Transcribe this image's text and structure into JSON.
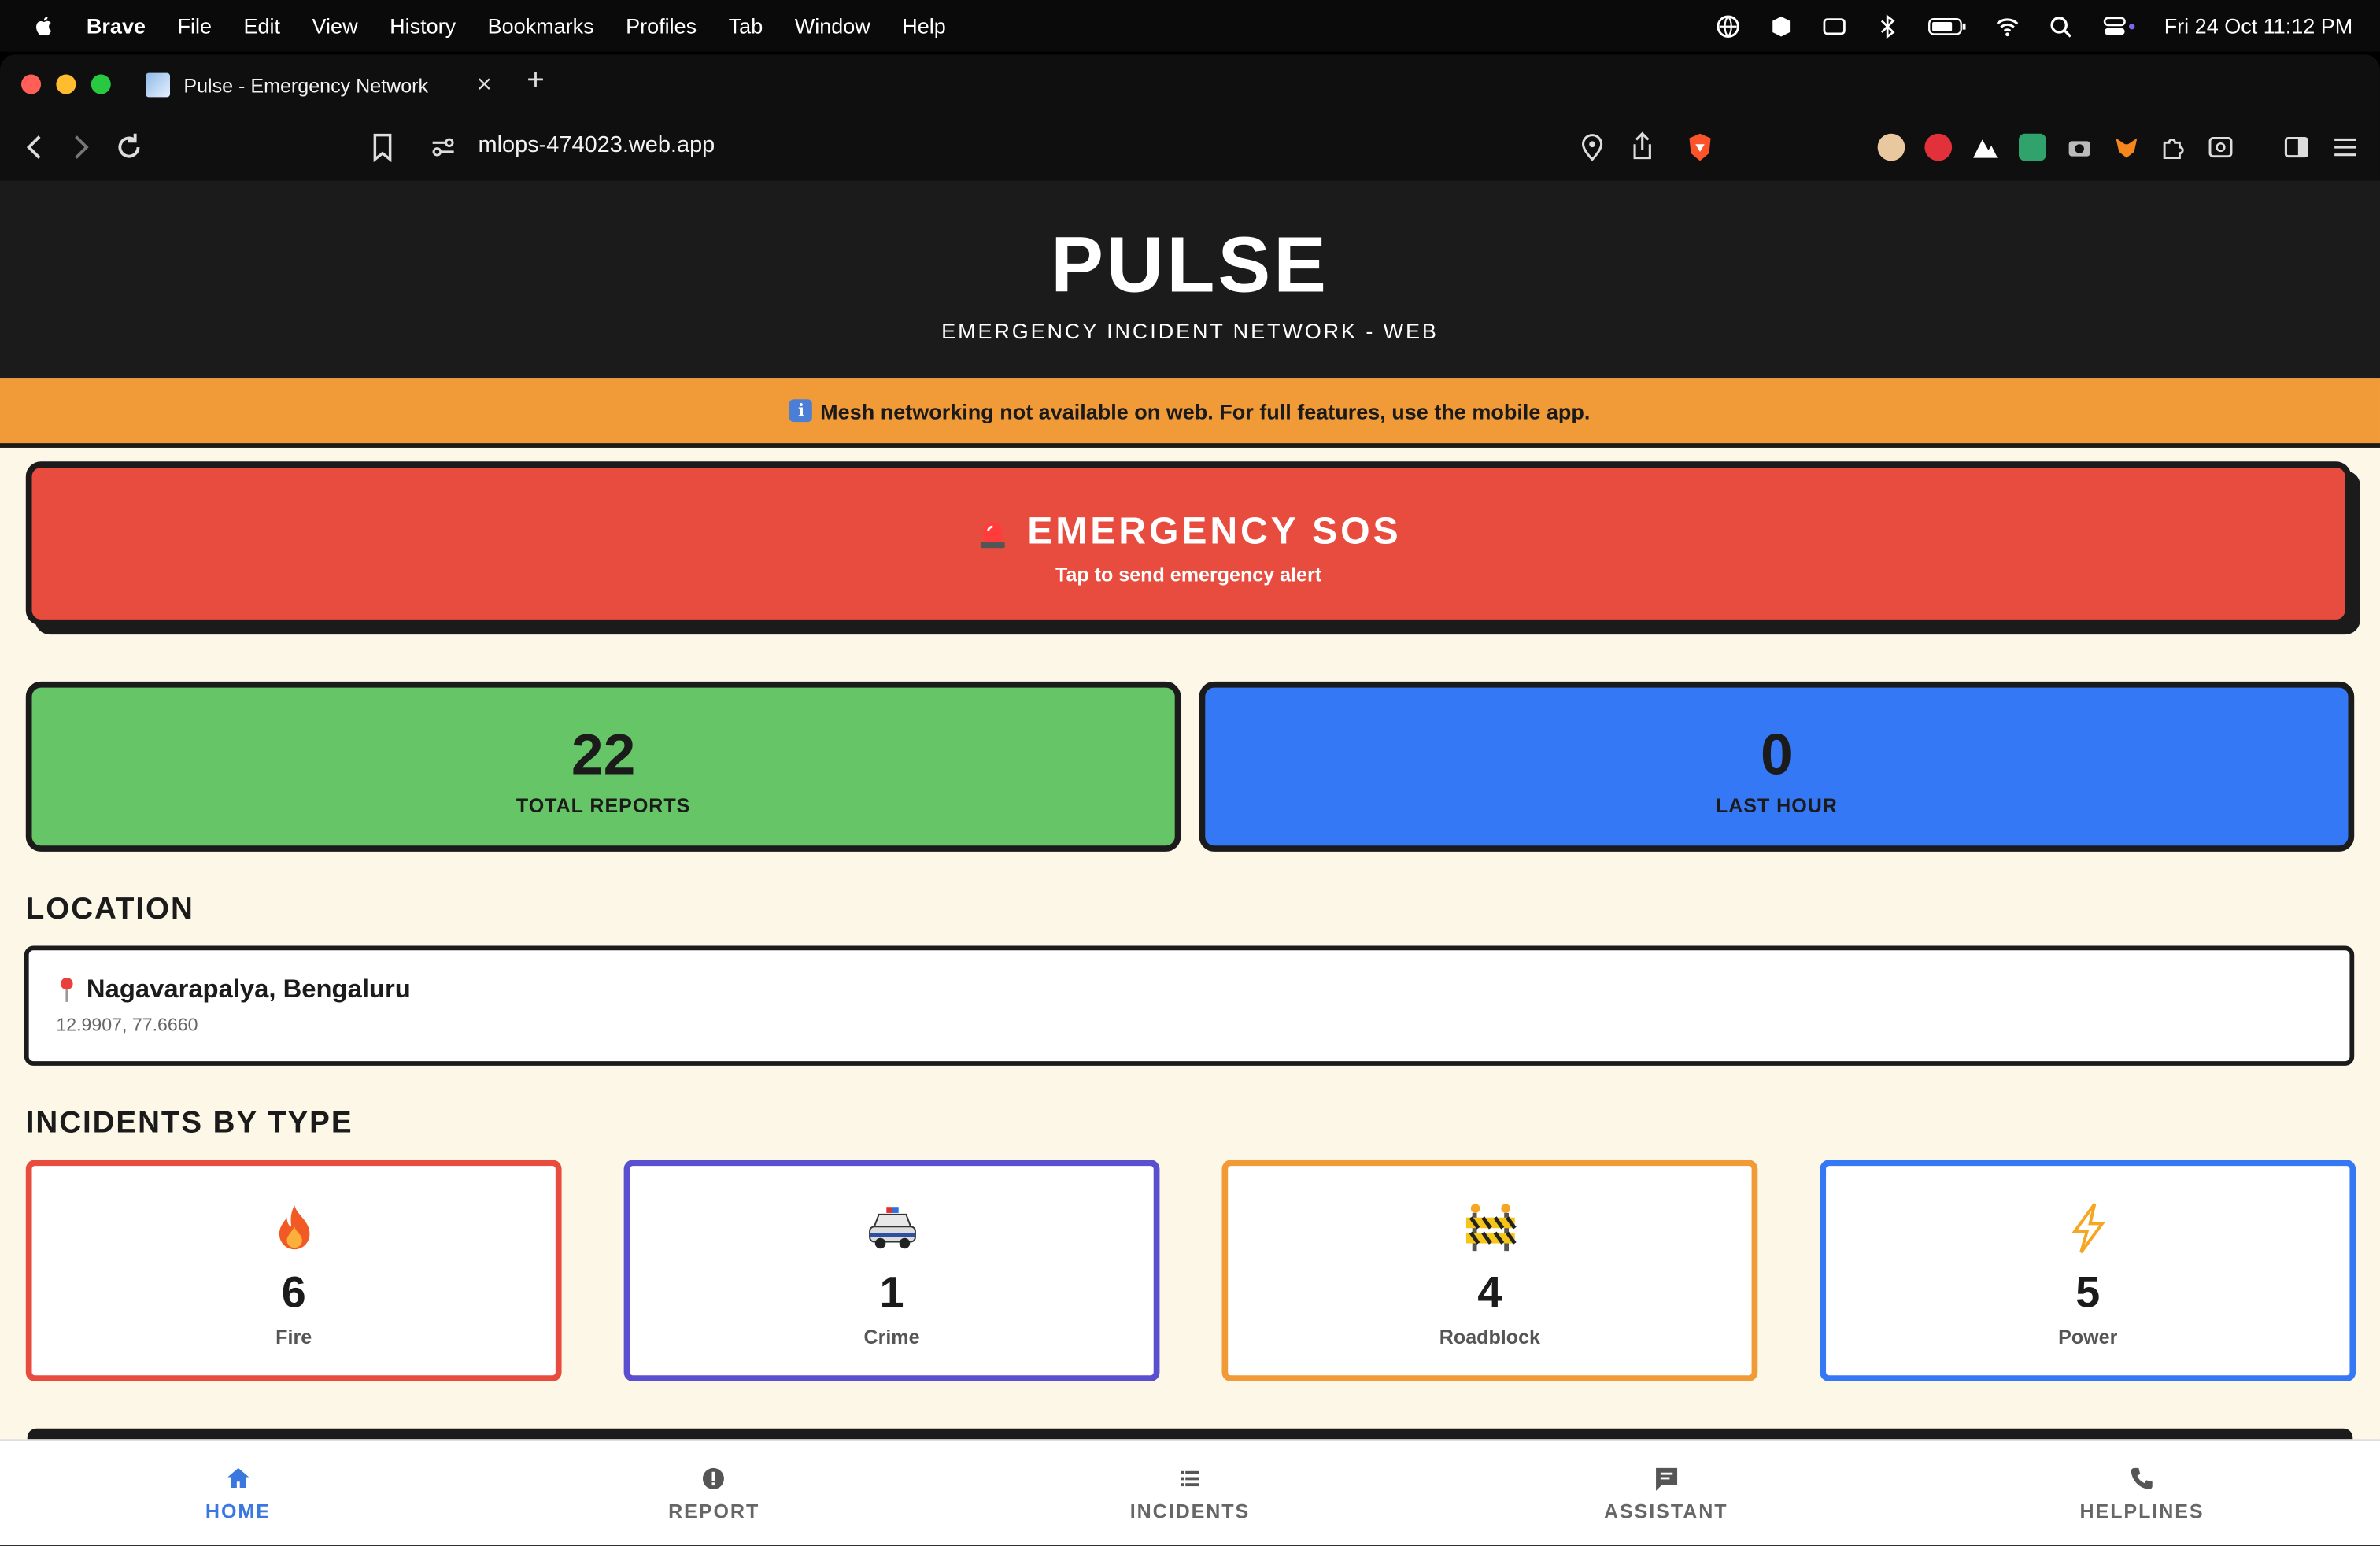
{
  "menubar": {
    "items": [
      "Brave",
      "File",
      "Edit",
      "View",
      "History",
      "Bookmarks",
      "Profiles",
      "Tab",
      "Window",
      "Help"
    ],
    "datetime": "Fri 24 Oct  11:12 PM"
  },
  "browser": {
    "tab_title": "Pulse - Emergency Network",
    "url": "mlops-474023.web.app"
  },
  "header": {
    "title": "PULSE",
    "subtitle": "EMERGENCY INCIDENT NETWORK - WEB"
  },
  "banner": {
    "icon": "info-icon",
    "icon_glyph": "i",
    "text": "Mesh networking not available on web. For full features, use the mobile app."
  },
  "sos": {
    "icon": "siren-icon",
    "title": "EMERGENCY SOS",
    "hint": "Tap to send emergency alert",
    "color": "#e84c3e"
  },
  "stats": {
    "total": {
      "value": "22",
      "label": "TOTAL REPORTS",
      "color": "#66c566"
    },
    "last_hour": {
      "value": "0",
      "label": "LAST HOUR",
      "color": "#3578f6"
    }
  },
  "location": {
    "heading": "LOCATION",
    "place": "Nagavarapalya, Bengaluru",
    "coords": "12.9907, 77.6660"
  },
  "incidents": {
    "heading": "INCIDENTS BY TYPE",
    "items": [
      {
        "icon": "fire-icon",
        "count": "6",
        "type": "Fire",
        "color": "#e84c3e"
      },
      {
        "icon": "police-car-icon",
        "count": "1",
        "type": "Crime",
        "color": "#5a4fcf"
      },
      {
        "icon": "roadblock-icon",
        "count": "4",
        "type": "Roadblock",
        "color": "#f09b38"
      },
      {
        "icon": "lightning-icon",
        "count": "5",
        "type": "Power",
        "color": "#3578f6"
      }
    ]
  },
  "bottom_nav": [
    {
      "icon": "home-icon",
      "label": "HOME",
      "active": true
    },
    {
      "icon": "report-icon",
      "label": "REPORT",
      "active": false
    },
    {
      "icon": "list-icon",
      "label": "INCIDENTS",
      "active": false
    },
    {
      "icon": "chat-icon",
      "label": "ASSISTANT",
      "active": false
    },
    {
      "icon": "phone-icon",
      "label": "HELPLINES",
      "active": false
    }
  ]
}
